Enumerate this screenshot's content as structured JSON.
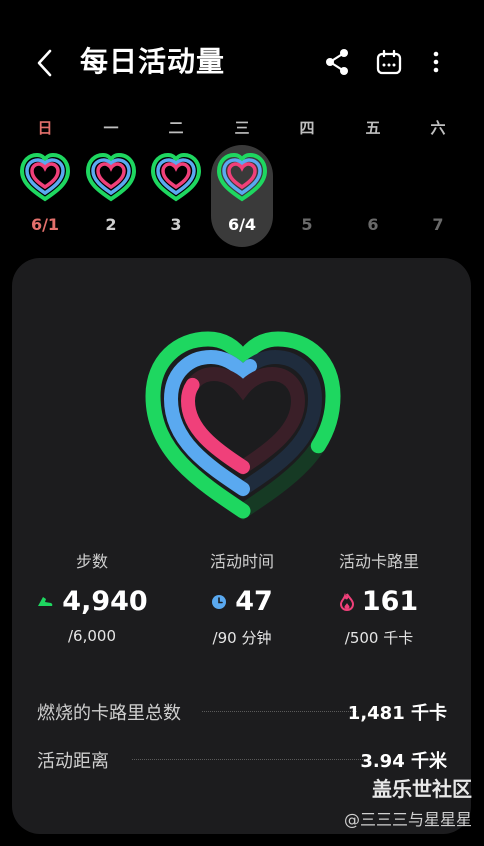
{
  "header": {
    "title": "每日活动量",
    "back_icon": "chevron-left-icon",
    "share_icon": "share-icon",
    "calendar_icon": "calendar-icon",
    "more_icon": "more-vertical-icon"
  },
  "weekdays": [
    "日",
    "一",
    "二",
    "三",
    "四",
    "五",
    "六"
  ],
  "days": [
    {
      "label": "6/1",
      "has_ring": true,
      "state": "sunday"
    },
    {
      "label": "2",
      "has_ring": true,
      "state": "normal"
    },
    {
      "label": "3",
      "has_ring": true,
      "state": "normal"
    },
    {
      "label": "6/4",
      "has_ring": true,
      "state": "selected"
    },
    {
      "label": "5",
      "has_ring": false,
      "state": "future"
    },
    {
      "label": "6",
      "has_ring": false,
      "state": "future"
    },
    {
      "label": "7",
      "has_ring": false,
      "state": "future"
    }
  ],
  "colors": {
    "steps": "#1ed760",
    "time": "#5aa9f0",
    "calories": "#f0407a",
    "sunday": "#e2706c",
    "card": "#1c1c1e"
  },
  "stats": {
    "steps": {
      "label": "步数",
      "value": "4,940",
      "goal": "/6,000",
      "icon": "shoe-icon",
      "progress": 0.823
    },
    "time": {
      "label": "活动时间",
      "value": "47",
      "goal": "/90 分钟",
      "icon": "clock-icon",
      "progress": 0.522
    },
    "calories": {
      "label": "活动卡路里",
      "value": "161",
      "goal": "/500 千卡",
      "icon": "flame-icon",
      "progress": 0.322
    }
  },
  "summary": {
    "burned": {
      "label": "燃烧的卡路里总数",
      "value": "1,481 千卡"
    },
    "distance": {
      "label": "活动距离",
      "value": "3.94 千米"
    }
  },
  "watermark": {
    "line1": "盖乐世社区",
    "line2": "@三三三与星星星"
  }
}
